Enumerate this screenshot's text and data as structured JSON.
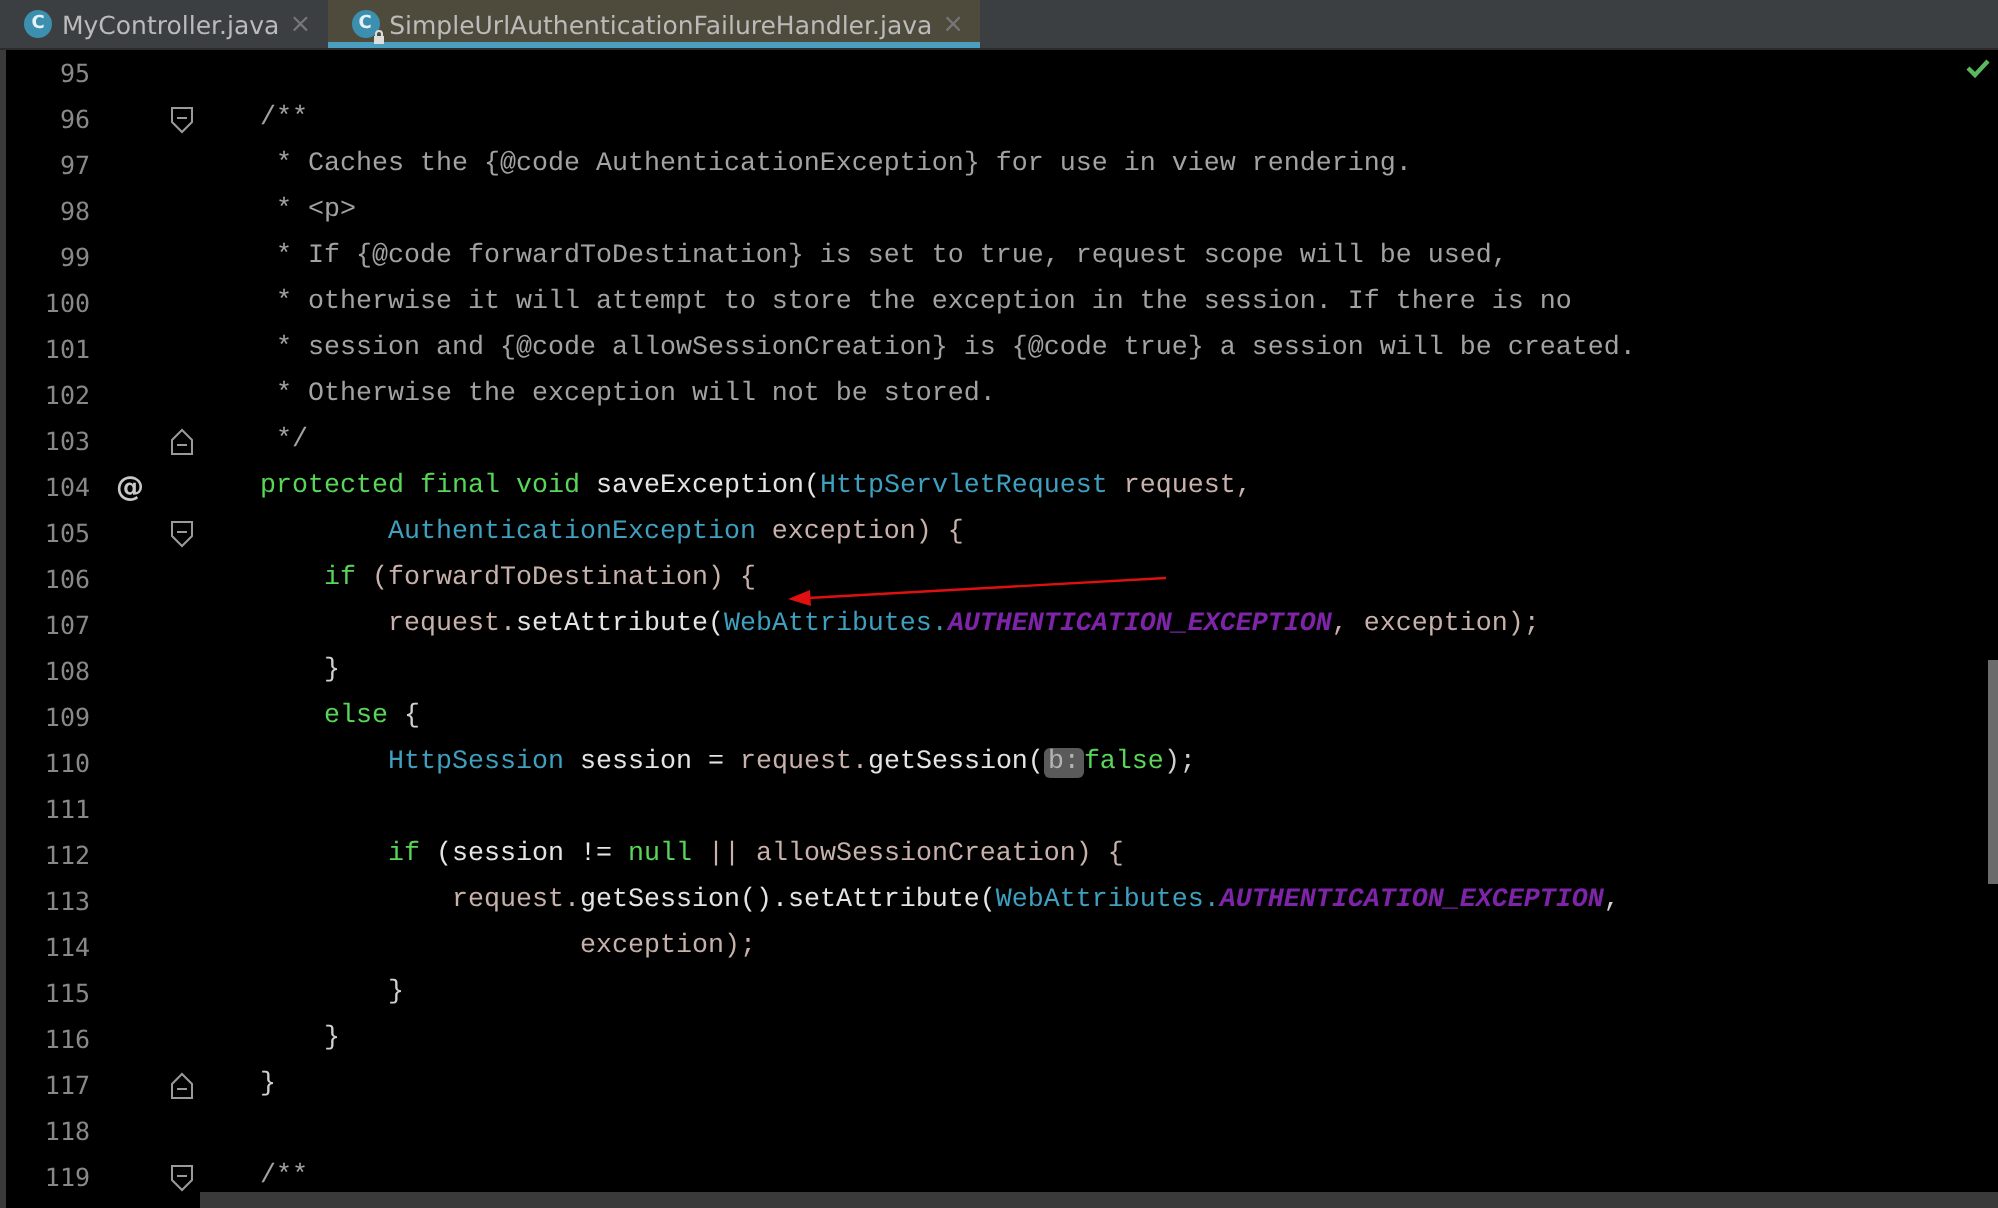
{
  "tabs": [
    {
      "icon_letter": "C",
      "label": "MyController.java",
      "close": "×",
      "selected": false,
      "locked": false
    },
    {
      "icon_letter": "C",
      "label": "SimpleUrlAuthenticationFailureHandler.java",
      "close": "×",
      "selected": true,
      "locked": true
    }
  ],
  "editor": {
    "inspection_ok": true,
    "lines": [
      {
        "number": "95",
        "fold_start": false,
        "fold_end": false
      },
      {
        "number": "96",
        "fold_start": true,
        "fold_end": false,
        "tokens": [
          {
            "kind": "comment",
            "text": "    /**"
          }
        ]
      },
      {
        "number": "97",
        "fold_start": false,
        "fold_end": false,
        "tokens": [
          {
            "kind": "comment",
            "text": "     * Caches the {@code AuthenticationException} for use in view rendering."
          }
        ]
      },
      {
        "number": "98",
        "fold_start": false,
        "fold_end": false,
        "tokens": [
          {
            "kind": "comment",
            "text": "     * <p>"
          }
        ]
      },
      {
        "number": "99",
        "fold_start": false,
        "fold_end": false,
        "tokens": [
          {
            "kind": "comment",
            "text": "     * If {@code forwardToDestination} is set to true, request scope will be used,"
          }
        ]
      },
      {
        "number": "100",
        "fold_start": false,
        "fold_end": false,
        "tokens": [
          {
            "kind": "comment",
            "text": "     * otherwise it will attempt to store the exception in the session. If there is no"
          }
        ]
      },
      {
        "number": "101",
        "fold_start": false,
        "fold_end": false,
        "tokens": [
          {
            "kind": "comment",
            "text": "     * session and {@code allowSessionCreation} is {@code true} a session will be created."
          }
        ]
      },
      {
        "number": "102",
        "fold_start": false,
        "fold_end": false,
        "tokens": [
          {
            "kind": "comment",
            "text": "     * Otherwise the exception will not be stored."
          }
        ]
      },
      {
        "number": "103",
        "fold_start": false,
        "fold_end": true,
        "tokens": [
          {
            "kind": "comment",
            "text": "     */"
          }
        ]
      },
      {
        "number": "104",
        "fold_start": false,
        "fold_end": false,
        "marker": "@",
        "tokens": [
          {
            "kind": "keyword",
            "text": "    protected final void "
          },
          {
            "kind": "method",
            "text": "saveException("
          },
          {
            "kind": "type",
            "text": "HttpServletRequest"
          },
          {
            "kind": "variable",
            "text": " request,"
          }
        ]
      },
      {
        "number": "105",
        "fold_start": true,
        "fold_end": false,
        "tokens": [
          {
            "kind": "type",
            "text": "            AuthenticationException"
          },
          {
            "kind": "variable",
            "text": " exception) {"
          }
        ]
      },
      {
        "number": "106",
        "fold_start": false,
        "fold_end": false,
        "tokens": [
          {
            "kind": "keyword",
            "text": "        if"
          },
          {
            "kind": "variable",
            "text": " (forwardToDestination) {"
          }
        ]
      },
      {
        "number": "107",
        "fold_start": false,
        "fold_end": false,
        "tokens": [
          {
            "kind": "variable",
            "text": "            request."
          },
          {
            "kind": "method",
            "text": "setAttribute("
          },
          {
            "kind": "type",
            "text": "WebAttributes."
          },
          {
            "kind": "constant",
            "text": "AUTHENTICATION_EXCEPTION"
          },
          {
            "kind": "variable",
            "text": ", exception);"
          }
        ]
      },
      {
        "number": "108",
        "fold_start": false,
        "fold_end": false,
        "tokens": [
          {
            "kind": "plain",
            "text": "        }"
          }
        ]
      },
      {
        "number": "109",
        "fold_start": false,
        "fold_end": false,
        "tokens": [
          {
            "kind": "keyword",
            "text": "        else"
          },
          {
            "kind": "plain",
            "text": " {"
          }
        ]
      },
      {
        "number": "110",
        "fold_start": false,
        "fold_end": false,
        "tokens": [
          {
            "kind": "type",
            "text": "            HttpSession"
          },
          {
            "kind": "method",
            "text": " session = "
          },
          {
            "kind": "variable",
            "text": "request."
          },
          {
            "kind": "method",
            "text": "getSession("
          },
          {
            "kind": "hint",
            "text": "b:"
          },
          {
            "kind": "keyword",
            "text": "false"
          },
          {
            "kind": "plain",
            "text": ");"
          }
        ]
      },
      {
        "number": "111",
        "fold_start": false,
        "fold_end": false
      },
      {
        "number": "112",
        "fold_start": false,
        "fold_end": false,
        "tokens": [
          {
            "kind": "keyword",
            "text": "            if"
          },
          {
            "kind": "method",
            "text": " (session != "
          },
          {
            "kind": "keyword",
            "text": "null"
          },
          {
            "kind": "variable",
            "text": " || allowSessionCreation) {"
          }
        ]
      },
      {
        "number": "113",
        "fold_start": false,
        "fold_end": false,
        "tokens": [
          {
            "kind": "variable",
            "text": "                request."
          },
          {
            "kind": "method",
            "text": "getSession().setAttribute("
          },
          {
            "kind": "type",
            "text": "WebAttributes."
          },
          {
            "kind": "constant",
            "text": "AUTHENTICATION_EXCEPTION"
          },
          {
            "kind": "plain",
            "text": ","
          }
        ]
      },
      {
        "number": "114",
        "fold_start": false,
        "fold_end": false,
        "tokens": [
          {
            "kind": "variable",
            "text": "                        exception);"
          }
        ]
      },
      {
        "number": "115",
        "fold_start": false,
        "fold_end": false,
        "tokens": [
          {
            "kind": "plain",
            "text": "            }"
          }
        ]
      },
      {
        "number": "116",
        "fold_start": false,
        "fold_end": false,
        "tokens": [
          {
            "kind": "plain",
            "text": "        }"
          }
        ]
      },
      {
        "number": "117",
        "fold_start": false,
        "fold_end": true,
        "tokens": [
          {
            "kind": "plain",
            "text": "    }"
          }
        ]
      },
      {
        "number": "118",
        "fold_start": false,
        "fold_end": false
      },
      {
        "number": "119",
        "fold_start": true,
        "fold_end": false,
        "tokens": [
          {
            "kind": "comment",
            "text": "    /**"
          }
        ]
      }
    ]
  }
}
